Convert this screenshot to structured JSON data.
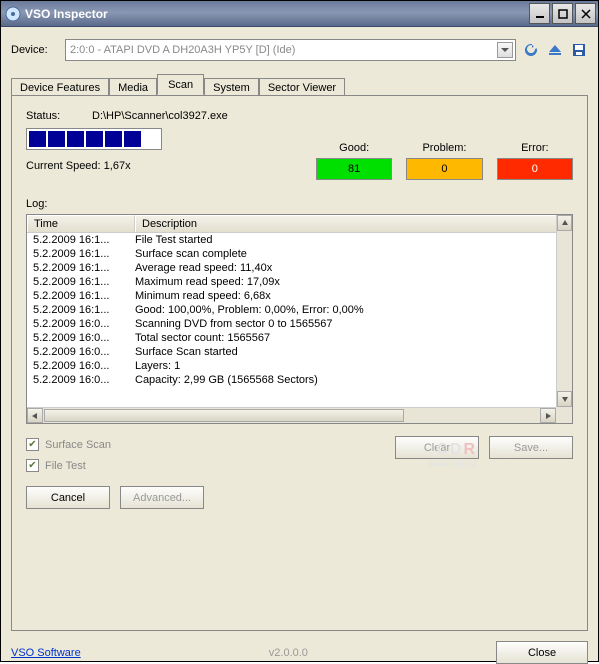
{
  "window": {
    "title": "VSO Inspector"
  },
  "device": {
    "label": "Device:",
    "selected": "2:0:0 - ATAPI DVD A  DH20A3H YP5Y [D] (Ide)"
  },
  "tabs": {
    "device_features": "Device Features",
    "media": "Media",
    "scan": "Scan",
    "system": "System",
    "sector_viewer": "Sector Viewer"
  },
  "scan": {
    "status_label": "Status:",
    "status_value": "D:\\HP\\Scanner\\col3927.exe",
    "speed_label": "Current Speed: 1,67x",
    "stats": {
      "good_label": "Good:",
      "good_value": "81",
      "prob_label": "Problem:",
      "prob_value": "0",
      "err_label": "Error:",
      "err_value": "0"
    },
    "log_label": "Log:",
    "columns": {
      "time": "Time",
      "desc": "Description"
    },
    "rows": [
      {
        "time": "5.2.2009 16:1...",
        "desc": "File Test started"
      },
      {
        "time": "5.2.2009 16:1...",
        "desc": "Surface scan complete"
      },
      {
        "time": "5.2.2009 16:1...",
        "desc": "Average read speed: 11,40x"
      },
      {
        "time": "5.2.2009 16:1...",
        "desc": "Maximum read speed: 17,09x"
      },
      {
        "time": "5.2.2009 16:1...",
        "desc": "Minimum read speed: 6,68x"
      },
      {
        "time": "5.2.2009 16:1...",
        "desc": "Good: 100,00%, Problem: 0,00%, Error: 0,00%"
      },
      {
        "time": "5.2.2009 16:0...",
        "desc": "Scanning DVD from sector 0 to 1565567"
      },
      {
        "time": "5.2.2009 16:0...",
        "desc": "Total sector count: 1565567"
      },
      {
        "time": "5.2.2009 16:0...",
        "desc": "Surface Scan started"
      },
      {
        "time": "5.2.2009 16:0...",
        "desc": "Layers: 1"
      },
      {
        "time": "5.2.2009 16:0...",
        "desc": "Capacity: 2,99 GB (1565568 Sectors)"
      }
    ],
    "checks": {
      "surface": "Surface Scan",
      "file": "File Test"
    },
    "buttons": {
      "clear": "Clear",
      "save": "Save...",
      "cancel": "Cancel",
      "advanced": "Advanced..."
    }
  },
  "footer": {
    "link": "VSO Software",
    "version": "v2.0.0.0",
    "close": "Close"
  },
  "watermark": {
    "l1": "C",
    "l2": "www.cdr.cz"
  }
}
